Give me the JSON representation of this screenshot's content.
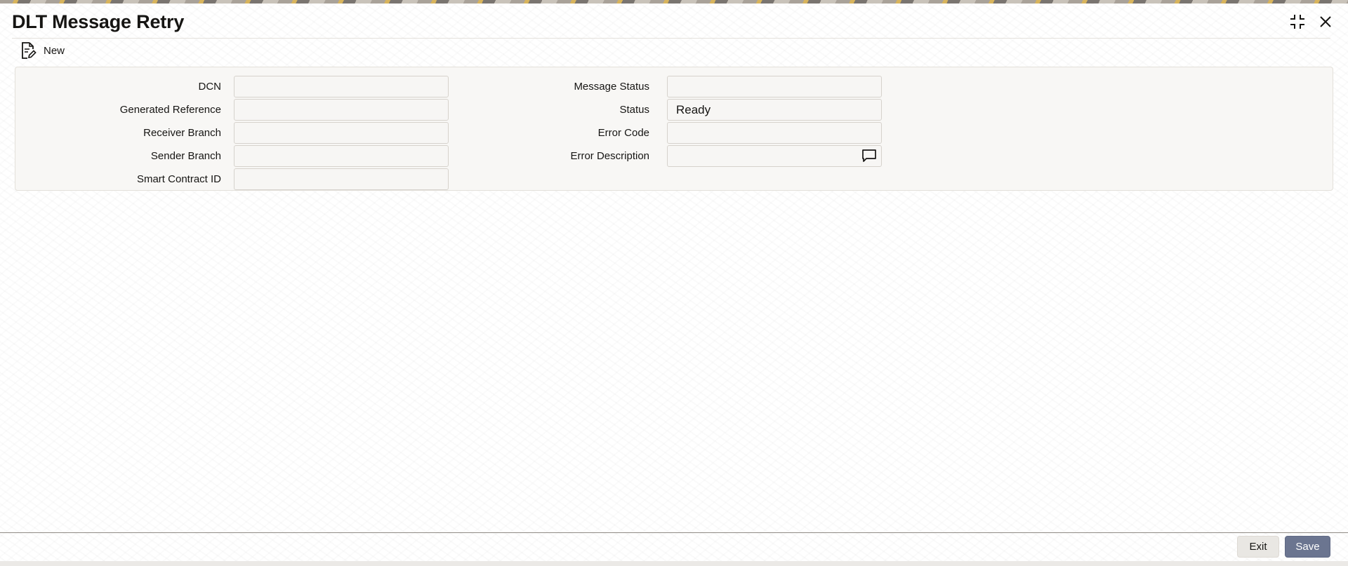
{
  "window": {
    "title": "DLT Message Retry"
  },
  "toolbar": {
    "new_label": "New"
  },
  "form": {
    "left": [
      {
        "label": "DCN",
        "value": ""
      },
      {
        "label": "Generated Reference",
        "value": ""
      },
      {
        "label": "Receiver Branch",
        "value": ""
      },
      {
        "label": "Sender Branch",
        "value": ""
      },
      {
        "label": "Smart Contract ID",
        "value": ""
      }
    ],
    "right": [
      {
        "label": "Message Status",
        "value": ""
      },
      {
        "label": "Status",
        "value": "Ready"
      },
      {
        "label": "Error Code",
        "value": ""
      },
      {
        "label": "Error Description",
        "value": ""
      }
    ]
  },
  "footer": {
    "exit_label": "Exit",
    "save_label": "Save"
  },
  "icons": {
    "new": "document-edit-icon",
    "minimize": "collapse-icon",
    "close": "close-icon",
    "error_description": "comment-icon"
  },
  "colors": {
    "save_button": "#6b7590",
    "exit_button": "#e9e7e3"
  }
}
